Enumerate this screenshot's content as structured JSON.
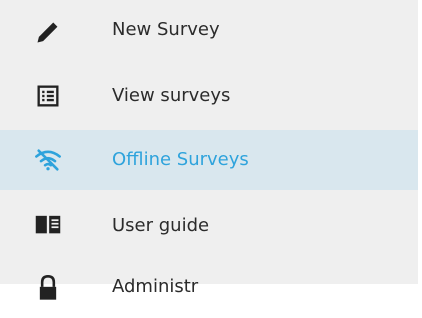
{
  "menu": {
    "items": [
      {
        "label": "New Survey",
        "icon": "pencil-icon",
        "active": false
      },
      {
        "label": "View surveys",
        "icon": "list-icon",
        "active": false
      },
      {
        "label": "Offline Surveys",
        "icon": "wifi-off-icon",
        "active": true
      },
      {
        "label": "User guide",
        "icon": "book-icon",
        "active": false
      },
      {
        "label": "Administr",
        "icon": "lock-icon",
        "active": false
      }
    ]
  },
  "colors": {
    "menu_bg": "#efefef",
    "active_bg": "#d9e7ee",
    "active_text": "#2ea3dc",
    "text": "#2b2b2b",
    "icon": "#222222"
  }
}
